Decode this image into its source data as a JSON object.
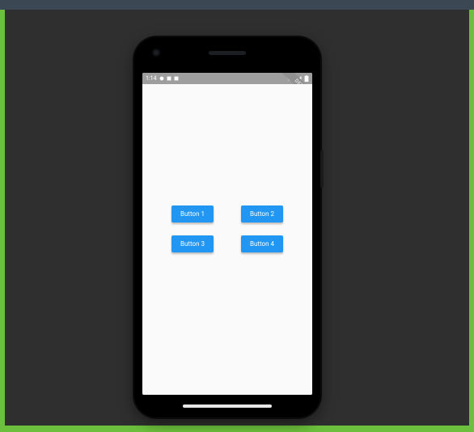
{
  "status_bar": {
    "time": "1:14",
    "icons_left": [
      "circle-icon",
      "square-icon",
      "square-icon"
    ],
    "icons_right": [
      "wifi-icon",
      "signal-icon",
      "battery-icon"
    ]
  },
  "debug_banner": {
    "label": "DEBUG"
  },
  "buttons": {
    "b1": "Button 1",
    "b2": "Button 2",
    "b3": "Button 3",
    "b4": "Button 4"
  },
  "colors": {
    "button_bg": "#2196f3",
    "button_fg": "#ffffff",
    "app_bg": "#fafafa",
    "status_bg": "#9e9e9e"
  }
}
